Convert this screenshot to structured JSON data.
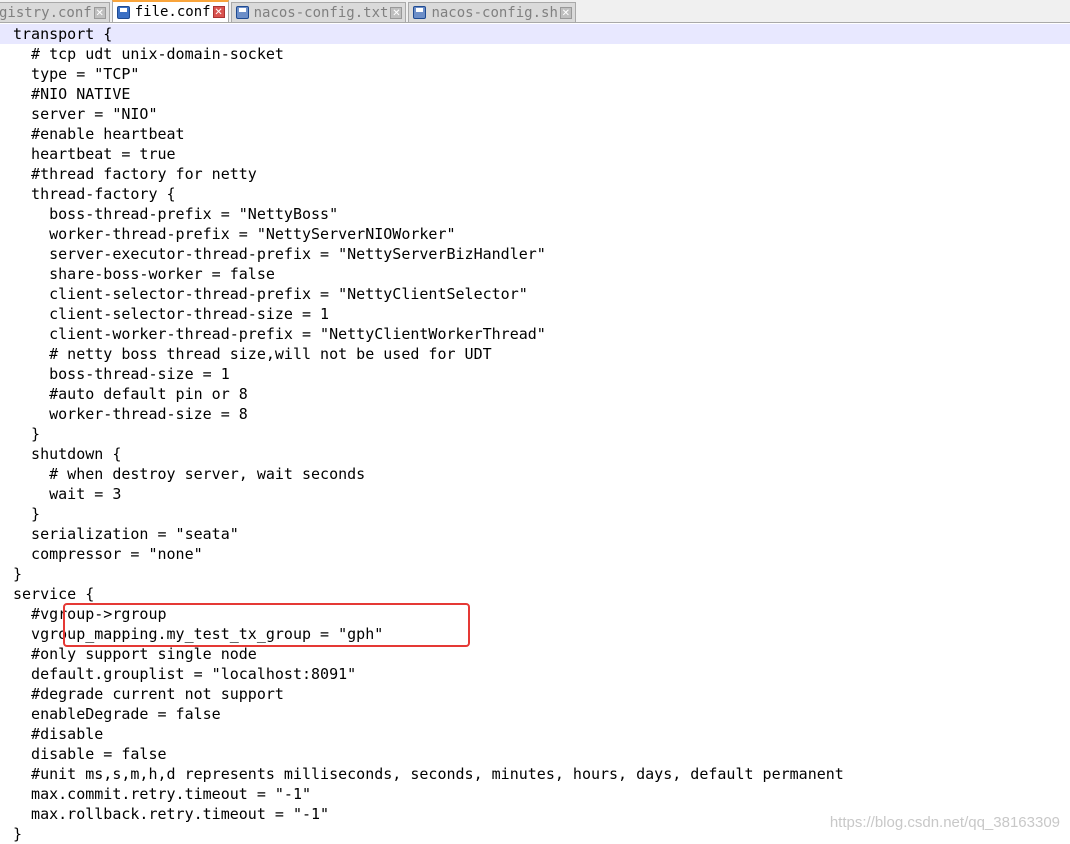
{
  "tabs": [
    {
      "label": "gistry.conf",
      "active": false
    },
    {
      "label": "file.conf",
      "active": true
    },
    {
      "label": "nacos-config.txt",
      "active": false
    },
    {
      "label": "nacos-config.sh",
      "active": false
    }
  ],
  "icons": {
    "file": "save-disk-icon",
    "close": "close-icon"
  },
  "code_lines": [
    "transport {",
    "  # tcp udt unix-domain-socket",
    "  type = \"TCP\"",
    "  #NIO NATIVE",
    "  server = \"NIO\"",
    "  #enable heartbeat",
    "  heartbeat = true",
    "  #thread factory for netty",
    "  thread-factory {",
    "    boss-thread-prefix = \"NettyBoss\"",
    "    worker-thread-prefix = \"NettyServerNIOWorker\"",
    "    server-executor-thread-prefix = \"NettyServerBizHandler\"",
    "    share-boss-worker = false",
    "    client-selector-thread-prefix = \"NettyClientSelector\"",
    "    client-selector-thread-size = 1",
    "    client-worker-thread-prefix = \"NettyClientWorkerThread\"",
    "    # netty boss thread size,will not be used for UDT",
    "    boss-thread-size = 1",
    "    #auto default pin or 8",
    "    worker-thread-size = 8",
    "  }",
    "  shutdown {",
    "    # when destroy server, wait seconds",
    "    wait = 3",
    "  }",
    "  serialization = \"seata\"",
    "  compressor = \"none\"",
    "}",
    "service {",
    "  #vgroup->rgroup",
    "  vgroup_mapping.my_test_tx_group = \"gph\"",
    "  #only support single node",
    "  default.grouplist = \"localhost:8091\"",
    "  #degrade current not support",
    "  enableDegrade = false",
    "  #disable",
    "  disable = false",
    "  #unit ms,s,m,h,d represents milliseconds, seconds, minutes, hours, days, default permanent",
    "  max.commit.retry.timeout = \"-1\"",
    "  max.rollback.retry.timeout = \"-1\"",
    "}"
  ],
  "watermark": "https://blog.csdn.net/qq_38163309",
  "colors": {
    "highlight_box": "#e53935",
    "current_line": "#e8e8ff",
    "active_tab_accent": "#f9a43a"
  }
}
